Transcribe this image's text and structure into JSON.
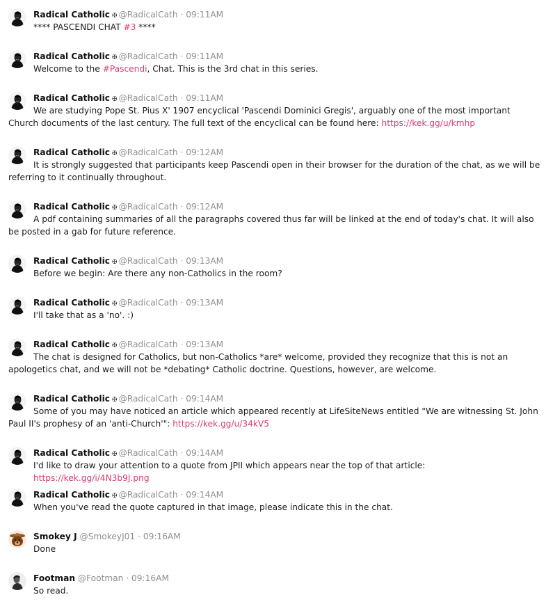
{
  "separator": " · ",
  "messages": [
    {
      "avatar": "pius-x-avatar",
      "name": "Radical Catholic",
      "badge": "✠",
      "handle": "@RadicalCath",
      "time": "09:11AM",
      "segments": [
        {
          "type": "text",
          "value": "**** PASCENDI CHAT "
        },
        {
          "type": "tag",
          "value": "#3"
        },
        {
          "type": "text",
          "value": " ****"
        }
      ]
    },
    {
      "avatar": "pius-x-avatar",
      "name": "Radical Catholic",
      "badge": "✠",
      "handle": "@RadicalCath",
      "time": "09:11AM",
      "segments": [
        {
          "type": "text",
          "value": "Welcome to the "
        },
        {
          "type": "tag",
          "value": "#Pascendi"
        },
        {
          "type": "text",
          "value": ", Chat. This is the 3rd chat in this series."
        }
      ]
    },
    {
      "avatar": "pius-x-avatar",
      "name": "Radical Catholic",
      "badge": "✠",
      "handle": "@RadicalCath",
      "time": "09:11AM",
      "segments": [
        {
          "type": "text",
          "value": "We are studying Pope St. Pius X' 1907 encyclical 'Pascendi Dominici Gregis', arguably one of the most important Church documents of the last century. The full text of the encyclical can be found here: "
        },
        {
          "type": "link",
          "value": "https://kek.gg/u/kmhp"
        }
      ]
    },
    {
      "avatar": "pius-x-avatar",
      "name": "Radical Catholic",
      "badge": "✠",
      "handle": "@RadicalCath",
      "time": "09:12AM",
      "segments": [
        {
          "type": "text",
          "value": "It is strongly suggested that participants keep Pascendi open in their browser for the duration of the chat, as we will be referring to it continually throughout."
        }
      ]
    },
    {
      "avatar": "pius-x-avatar",
      "name": "Radical Catholic",
      "badge": "✠",
      "handle": "@RadicalCath",
      "time": "09:12AM",
      "segments": [
        {
          "type": "text",
          "value": "A pdf containing summaries of all the paragraphs covered thus far will be linked at the end of today's chat. It will also be posted in a gab for future reference."
        }
      ]
    },
    {
      "avatar": "pius-x-avatar",
      "name": "Radical Catholic",
      "badge": "✠",
      "handle": "@RadicalCath",
      "time": "09:13AM",
      "segments": [
        {
          "type": "text",
          "value": "Before we begin: Are there any non-Catholics in the room?"
        }
      ]
    },
    {
      "avatar": "pius-x-avatar",
      "name": "Radical Catholic",
      "badge": "✠",
      "handle": "@RadicalCath",
      "time": "09:13AM",
      "segments": [
        {
          "type": "text",
          "value": "I'll take that as a 'no'. :)"
        }
      ]
    },
    {
      "avatar": "pius-x-avatar",
      "name": "Radical Catholic",
      "badge": "✠",
      "handle": "@RadicalCath",
      "time": "09:13AM",
      "segments": [
        {
          "type": "text",
          "value": "The chat is designed for Catholics, but non-Catholics *are* welcome, provided they recognize that this is not an apologetics chat, and we will not be *debating* Catholic doctrine. Questions, however, are welcome."
        }
      ]
    },
    {
      "avatar": "pius-x-avatar",
      "name": "Radical Catholic",
      "badge": "✠",
      "handle": "@RadicalCath",
      "time": "09:14AM",
      "segments": [
        {
          "type": "text",
          "value": "Some of you may have noticed an article which appeared recently at LifeSiteNews entitled \"We are witnessing St. John Paul II's prophesy of an 'anti-Church'\": "
        },
        {
          "type": "link",
          "value": "https://kek.gg/u/34kV5"
        }
      ]
    },
    {
      "avatar": "pius-x-avatar",
      "name": "Radical Catholic",
      "badge": "✠",
      "handle": "@RadicalCath",
      "time": "09:14AM",
      "segments": [
        {
          "type": "text",
          "value": "I'd like to draw your attention to a quote from JPII which appears near the top of that article: "
        },
        {
          "type": "link",
          "value": "https://kek.gg/i/4N3b9J.png"
        }
      ]
    },
    {
      "avatar": "pius-x-avatar",
      "name": "Radical Catholic",
      "badge": "✠",
      "handle": "@RadicalCath",
      "time": "09:14AM",
      "segments": [
        {
          "type": "text",
          "value": "When you've read the quote captured in that image, please indicate this in the chat."
        }
      ]
    },
    {
      "avatar": "smokey-bear-avatar",
      "name": "Smokey J",
      "badge": "",
      "handle": "@SmokeyJ01",
      "time": "09:16AM",
      "segments": [
        {
          "type": "text",
          "value": "Done"
        }
      ]
    },
    {
      "avatar": "footman-avatar",
      "name": "Footman",
      "badge": "",
      "handle": "@Footman",
      "time": "09:16AM",
      "segments": [
        {
          "type": "text",
          "value": "So read."
        }
      ]
    }
  ]
}
